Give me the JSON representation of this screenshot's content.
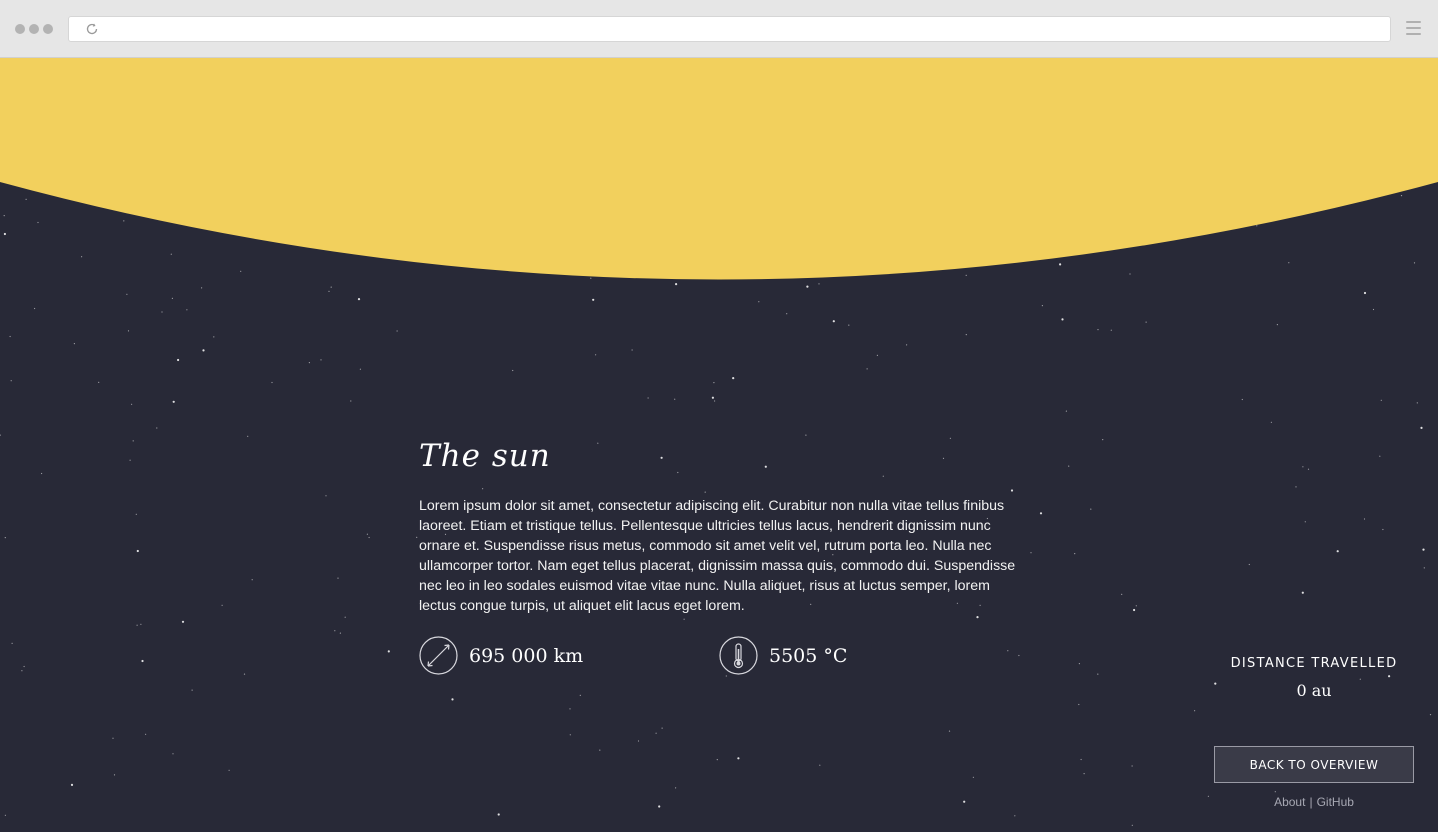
{
  "browser": {
    "reload_icon": "reload-icon",
    "menu_icon": "hamburger-menu-icon"
  },
  "colors": {
    "background": "#282937",
    "sun": "#f2d05d",
    "text": "#ffffff"
  },
  "planet": {
    "title": "The sun",
    "description": "Lorem ipsum dolor sit amet, consectetur adipiscing elit. Curabitur non nulla vitae tellus finibus laoreet. Etiam et tristique tellus. Pellentesque ultricies tellus lacus, hendrerit dignissim nunc ornare et. Suspendisse risus metus, commodo sit amet velit vel, rutrum porta leo. Nulla nec ullamcorper tortor. Nam eget tellus placerat, dignissim massa quis, commodo dui. Suspendisse nec leo in leo sodales euismod vitae vitae nunc. Nulla aliquet, risus at luctus semper, lorem lectus congue turpis, ut aliquet elit lacus eget lorem.",
    "stats": {
      "radius": {
        "icon": "diameter-icon",
        "value": "695 000 km"
      },
      "temperature": {
        "icon": "thermometer-icon",
        "value": "5505 °C"
      }
    }
  },
  "distance": {
    "label": "DISTANCE TRAVELLED",
    "value": "0 au"
  },
  "back_button": {
    "label": "BACK TO OVERVIEW"
  },
  "footer": {
    "about": "About",
    "separator": "|",
    "github": "GitHub"
  }
}
